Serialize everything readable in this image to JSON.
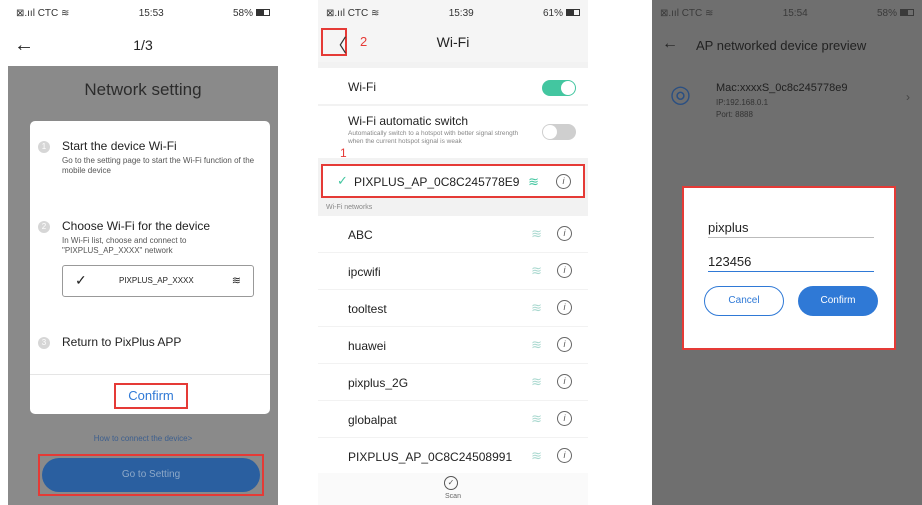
{
  "colors": {
    "accent": "#2f79d6",
    "highlight": "#e53a36",
    "toggle_on": "#43c6a0",
    "overlay": "#8a8a8a"
  },
  "phone1": {
    "status": {
      "carrier": "⊠.ııl CTC ≋",
      "time": "15:53",
      "battery": "58%"
    },
    "nav": {
      "back_icon": "arrow-left-icon",
      "title": "1/3"
    },
    "heading": "Network setting",
    "steps": [
      {
        "number": "1",
        "title": "Start the device Wi-Fi",
        "desc": "Go to the setting page to start the Wi-Fi function of the mobile device"
      },
      {
        "number": "2",
        "title": "Choose Wi-Fi for the device",
        "desc": "In Wi-Fi list, choose and connect to \"PIXPLUS_AP_XXXX\" network"
      },
      {
        "number": "3",
        "title": "Return to PixPlus APP",
        "desc": ""
      }
    ],
    "wifi_example": "PIXPLUS_AP_XXXX",
    "confirm_label": "Confirm",
    "howto_link": "How to connect the device>",
    "go_setting_label": "Go to Setting"
  },
  "phone2": {
    "status": {
      "carrier": "⊠.ııl CTC ≋",
      "time": "15:39",
      "battery": "61%"
    },
    "nav": {
      "title": "Wi-Fi",
      "back_icon": "chevron-left-icon",
      "annotation": "2"
    },
    "wifi_toggle": {
      "label": "Wi-Fi",
      "on": true
    },
    "auto_switch": {
      "label": "Wi-Fi automatic switch",
      "sub": "Automatically switch to a hotspot with better signal strength when the current hotspot signal is weak",
      "on": false
    },
    "connected_annotation": "1",
    "connected": "PIXPLUS_AP_0C8C245778E9",
    "section_label": "Wi-Fi networks",
    "networks": [
      "ABC",
      "ipcwifi",
      "tooltest",
      "huawei",
      "pixplus_2G",
      "globalpat",
      "PIXPLUS_AP_0C8C24508991"
    ],
    "scan_label": "Scan"
  },
  "phone3": {
    "status": {
      "carrier": "⊠.ııl CTC ≋",
      "time": "15:54",
      "battery": "58%"
    },
    "nav": {
      "back_icon": "arrow-left-icon",
      "title": "AP networked device preview"
    },
    "device": {
      "mac": "Mac:xxxxS_0c8c245778e9",
      "ip": "IP:192.168.0.1",
      "port": "Port: 8888"
    },
    "dialog": {
      "username": "pixplus",
      "password": "123456",
      "cancel_label": "Cancel",
      "confirm_label": "Confirm"
    }
  }
}
